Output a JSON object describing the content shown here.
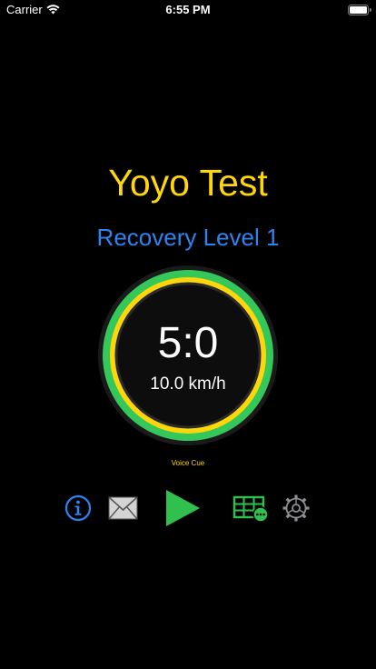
{
  "status_bar": {
    "carrier": "Carrier",
    "time": "6:55 PM",
    "wifi_icon": "wifi-icon",
    "battery_icon": "battery-icon"
  },
  "header": {
    "title": "Yoyo Test",
    "level": "Recovery Level 1"
  },
  "timer": {
    "time": "5:0",
    "speed": "10.0 km/h"
  },
  "voice_cue": "Voice Cue",
  "toolbar": {
    "info_icon": "info-icon",
    "mail_icon": "envelope-icon",
    "play_icon": "play-icon",
    "schedule_icon": "table-icon",
    "settings_icon": "gear-icon"
  },
  "colors": {
    "background": "#000000",
    "title_yellow": "#ffd60a",
    "level_blue": "#2f83f0",
    "ring_green": "#34c759",
    "ring_yellow": "#ffd60a",
    "play_green": "#30c04e",
    "settings_gray": "#8e8e93"
  }
}
